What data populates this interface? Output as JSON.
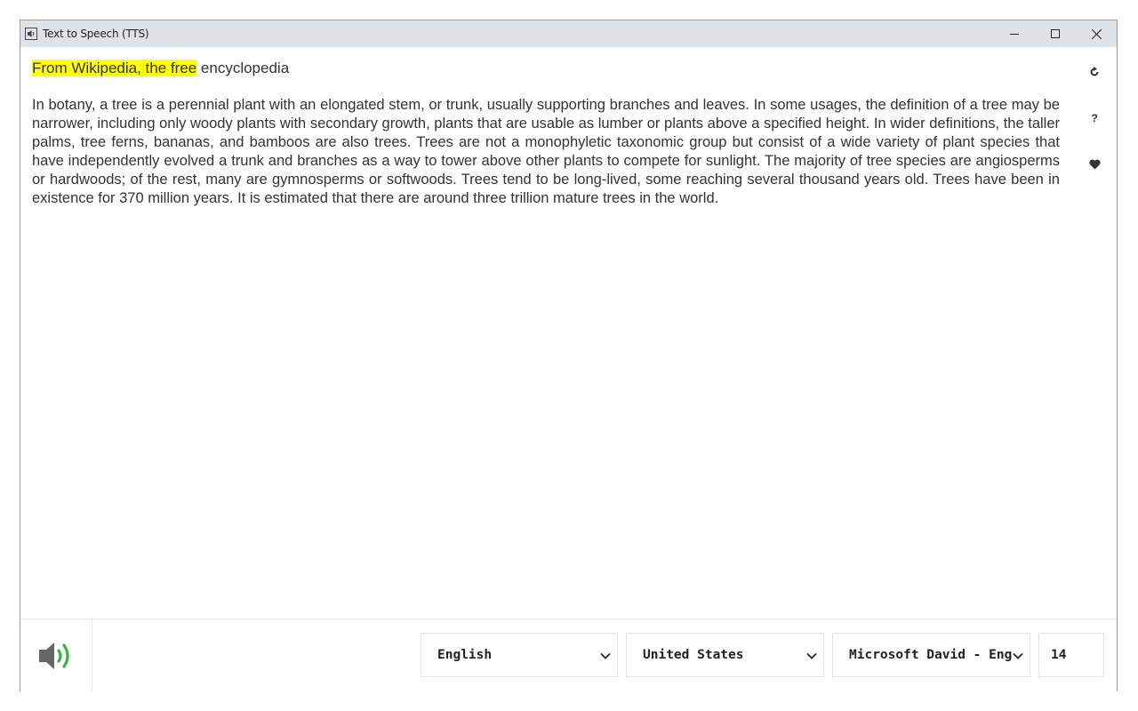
{
  "window": {
    "title": "Text to Speech (TTS)"
  },
  "document": {
    "heading_highlighted": "From Wikipedia, the free",
    "heading_rest": " encyclopedia",
    "paragraph": "In botany, a tree is a perennial plant with an elongated stem, or trunk, usually supporting branches and leaves. In some usages, the definition of a tree may be narrower, including only woody plants with secondary growth, plants that are usable as lumber or plants above a specified height. In wider definitions, the taller palms, tree ferns, bananas, and bamboos are also trees. Trees are not a monophyletic taxonomic group but consist of a wide variety of plant species that have independently evolved a trunk and branches as a way to tower above other plants to compete for sunlight. The majority of tree species are angiosperms or hardwoods; of the rest, many are gymnosperms or softwoods. Trees tend to be long-lived, some reaching several thousand years old. Trees have been in existence for 370 million years. It is estimated that there are around three trillion mature trees in the world."
  },
  "side_tools": {
    "help_label": "?",
    "icons": [
      "refresh-icon",
      "help-icon",
      "heart-icon"
    ]
  },
  "controls": {
    "language": "English",
    "region": "United States",
    "voice": "Microsoft David - English (United States)",
    "rate": "14"
  },
  "colors": {
    "highlight": "#ffff00",
    "speaker_wave": "#3cb043",
    "speaker_body": "#666666",
    "titlebar": "#dfe3e8"
  }
}
